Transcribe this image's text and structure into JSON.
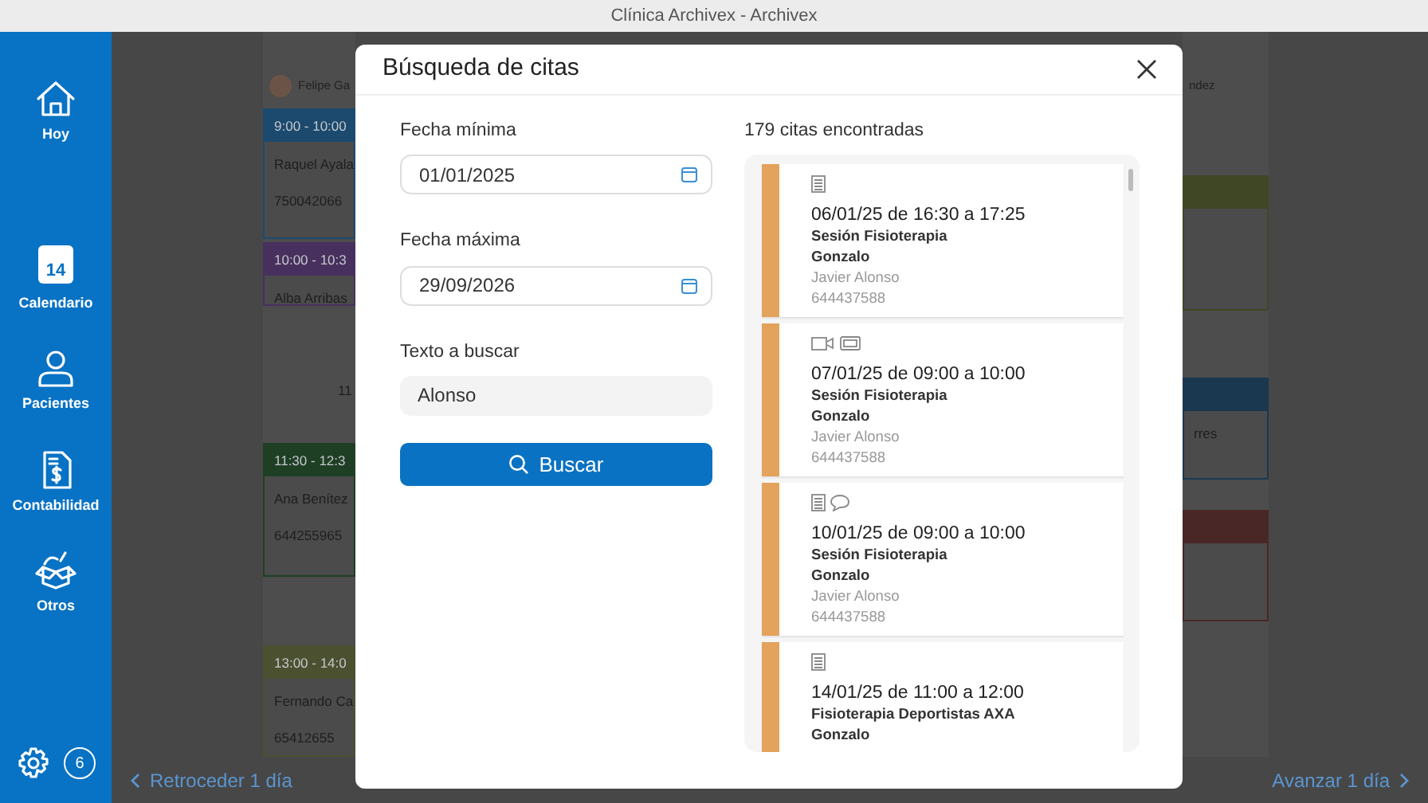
{
  "window": {
    "title": "Clínica Archivex - Archivex"
  },
  "sidebar": {
    "items": [
      {
        "label": "Hoy",
        "kind": "home"
      },
      {
        "label": "Calendario",
        "kind": "calendar",
        "icon_text": "14"
      },
      {
        "label": "Pacientes",
        "kind": "person"
      },
      {
        "label": "Contabilidad",
        "kind": "invoice"
      },
      {
        "label": "Otros",
        "kind": "box"
      }
    ],
    "notifications": "6"
  },
  "calendar": {
    "columns": [
      {
        "header": "Felipe Ga",
        "avatar": true,
        "items": [
          {
            "kind": "event",
            "time": "9:00 - 10:00",
            "color": "#1c4a6e",
            "lines": [
              "Raquel Ayala",
              "750042066"
            ]
          },
          {
            "kind": "event",
            "time": "10:00 - 10:3",
            "color": "#48305e",
            "lines": [
              "Alba Arribas"
            ]
          },
          {
            "kind": "label",
            "text": "11"
          },
          {
            "kind": "event",
            "time": "11:30 - 12:3",
            "color": "#1f3f24",
            "lines": [
              "Ana Benítez",
              "644255965"
            ]
          },
          {
            "kind": "event",
            "time": "13:00 - 14:0",
            "color": "#4b5130",
            "lines": [
              "Fernando Ca",
              "65412655"
            ]
          }
        ]
      },
      {
        "header": "ndez",
        "items": [
          {
            "kind": "event",
            "color": "#3f4725"
          },
          {
            "kind": "event",
            "color": "#1a3850",
            "lines": [
              "rres"
            ]
          },
          {
            "kind": "event",
            "color": "#4a2727"
          }
        ]
      }
    ],
    "prev": "Retroceder 1 día",
    "next": "Avanzar 1 día"
  },
  "modal": {
    "title": "Búsqueda de citas",
    "fields": [
      {
        "label": "Fecha mínima",
        "value": "01/01/2025",
        "kind": "date"
      },
      {
        "label": "Fecha máxima",
        "value": "29/09/2026",
        "kind": "date"
      },
      {
        "label": "Texto a buscar",
        "value": "Alonso",
        "kind": "text"
      }
    ],
    "search_button": "Buscar",
    "results_count": "179 citas encontradas",
    "results": [
      {
        "color": "#e3a35c",
        "icons": [
          {
            "kind": "note"
          }
        ],
        "datetime": "06/01/25 de 16:30 a 17:25",
        "service": "Sesión Fisioterapia",
        "professional": "Gonzalo",
        "patient": "Javier Alonso",
        "phone": "644437588"
      },
      {
        "color": "#e3a35c",
        "icons": [
          {
            "kind": "video"
          },
          {
            "kind": "ticket"
          }
        ],
        "datetime": "07/01/25 de 09:00 a 10:00",
        "service": "Sesión Fisioterapia",
        "professional": "Gonzalo",
        "patient": "Javier Alonso",
        "phone": "644437588"
      },
      {
        "color": "#e3a35c",
        "icons": [
          {
            "kind": "note"
          },
          {
            "kind": "chat"
          }
        ],
        "datetime": "10/01/25 de 09:00 a 10:00",
        "service": "Sesión Fisioterapia",
        "professional": "Gonzalo",
        "patient": "Javier Alonso",
        "phone": "644437588"
      },
      {
        "color": "#e3a35c",
        "icons": [
          {
            "kind": "note"
          }
        ],
        "datetime": "14/01/25 de 11:00 a 12:00",
        "service": "Fisioterapia Deportistas AXA",
        "professional": "Gonzalo"
      }
    ]
  }
}
